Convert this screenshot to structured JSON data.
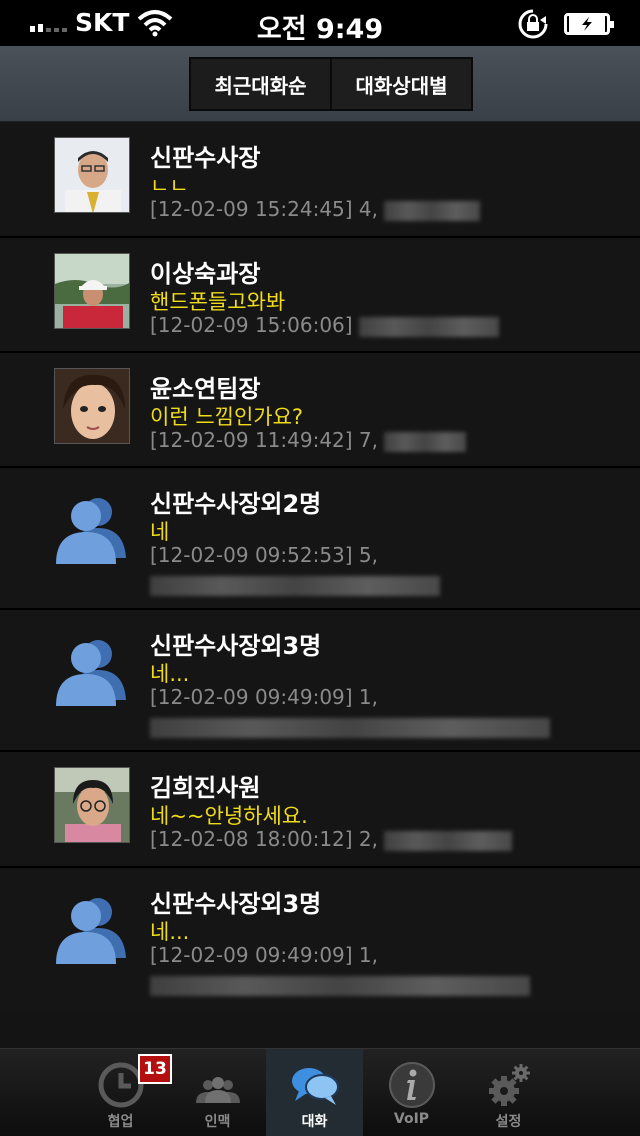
{
  "status_bar": {
    "carrier": "SKT",
    "time": "오전 9:49"
  },
  "header": {
    "segments": [
      {
        "label": "최근대화순"
      },
      {
        "label": "대화상대별"
      }
    ]
  },
  "conversations": [
    {
      "name": "신판수사장",
      "message": "ㄴㄴ",
      "meta": "[12-02-09 15:24:45] 4,"
    },
    {
      "name": "이상숙과장",
      "message": "핸드폰들고와봐",
      "meta": "[12-02-09 15:06:06]"
    },
    {
      "name": "윤소연팀장",
      "message": "이런 느낌인가요?",
      "meta": "[12-02-09 11:49:42] 7,"
    },
    {
      "name": "신판수사장외2명",
      "message": "네",
      "meta": "[12-02-09 09:52:53] 5,"
    },
    {
      "name": "신판수사장외3명",
      "message": "네...",
      "meta": "[12-02-09 09:49:09] 1,"
    },
    {
      "name": "김희진사원",
      "message": "네~~안녕하세요.",
      "meta": "[12-02-08 18:00:12] 2,"
    },
    {
      "name": "신판수사장외3명",
      "message": "네...",
      "meta": "[12-02-09 09:49:09] 1,"
    }
  ],
  "tabbar": {
    "badge": "13",
    "tabs": [
      {
        "label": "협업",
        "icon": "clock-icon"
      },
      {
        "label": "인맥",
        "icon": "people-icon"
      },
      {
        "label": "대화",
        "icon": "chat-bubbles-icon"
      },
      {
        "label": "VoIP",
        "icon": "info-icon"
      },
      {
        "label": "설정",
        "icon": "gears-icon"
      }
    ]
  }
}
